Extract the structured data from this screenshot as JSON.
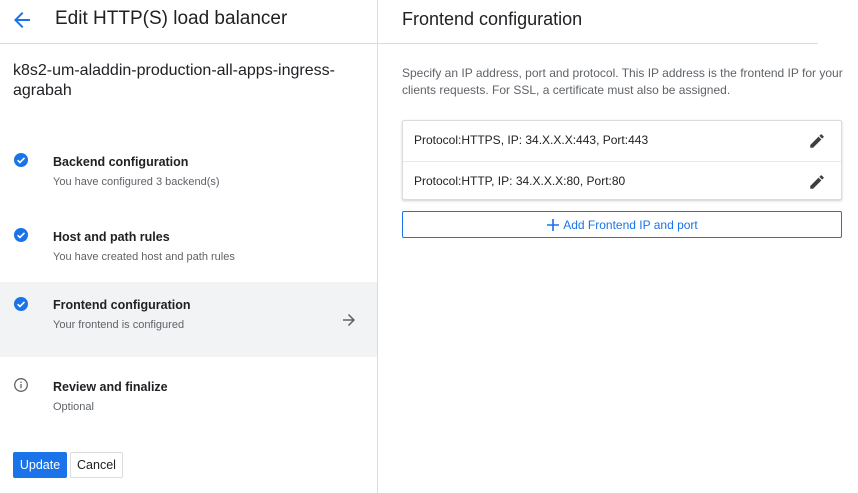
{
  "header": {
    "title": "Edit HTTP(S) load balancer",
    "back_icon": "arrow-back-icon"
  },
  "load_balancer_name": "k8s2-um-aladdin-production-all-apps-ingress-agrabah",
  "steps": [
    {
      "title": "Backend configuration",
      "subtitle": "You have configured 3 backend(s)",
      "status": "done",
      "active": false
    },
    {
      "title": "Host and path rules",
      "subtitle": "You have created host and path rules",
      "status": "done",
      "active": false
    },
    {
      "title": "Frontend configuration",
      "subtitle": "Your frontend is configured",
      "status": "done",
      "active": true
    },
    {
      "title": "Review and finalize",
      "subtitle": "Optional",
      "status": "info",
      "active": false
    }
  ],
  "actions": {
    "update_label": "Update",
    "cancel_label": "Cancel"
  },
  "frontend": {
    "title": "Frontend configuration",
    "description": "Specify an IP address, port and protocol. This IP address is the frontend IP for your clients requests. For SSL, a certificate must also be assigned.",
    "entries": [
      {
        "text": "Protocol:HTTPS, IP: 34.X.X.X:443, Port:443"
      },
      {
        "text": "Protocol:HTTP, IP: 34.X.X.X:80, Port:80"
      }
    ],
    "add_label": "Add Frontend IP and port"
  },
  "colors": {
    "accent": "#1a73e8",
    "active_bg": "#f1f3f4",
    "muted_text": "#5f6368",
    "border": "#dadce0"
  }
}
